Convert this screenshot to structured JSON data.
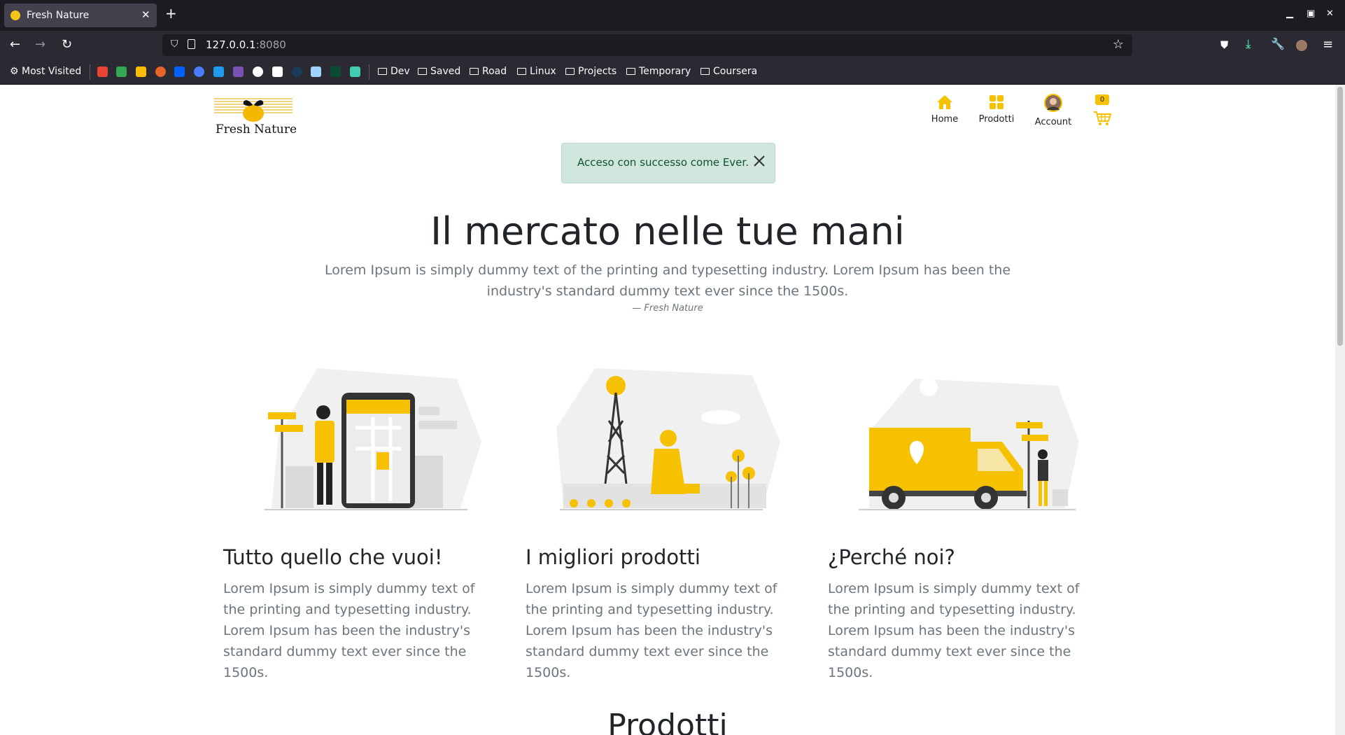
{
  "browser": {
    "tab_title": "Fresh Nature",
    "tab_close": "✕",
    "new_tab": "+",
    "url_host": "127.0.0.1",
    "url_port": ":8080",
    "bookmarks": {
      "most_visited": "Most Visited",
      "folders": [
        "Dev",
        "Saved",
        "Road",
        "Linux",
        "Projects",
        "Temporary",
        "Coursera"
      ]
    },
    "icons": [
      "back-arrow-icon",
      "forward-arrow-icon",
      "reload-icon",
      "shield-icon",
      "star-icon",
      "pocket-icon",
      "download-icon",
      "wrench-icon",
      "account-icon",
      "menu-icon"
    ]
  },
  "site": {
    "logo_text": "Fresh Nature",
    "nav": {
      "home": "Home",
      "products": "Prodotti",
      "account": "Account",
      "cart_count": "0"
    },
    "alert": {
      "message": "Acceso con successo come Ever."
    },
    "hero": {
      "title": "Il mercato nelle tue mani",
      "text": "Lorem Ipsum is simply dummy text of the printing and typesetting industry. Lorem Ipsum has been the industry's standard dummy text ever since the 1500s.",
      "cite": "— Fresh Nature"
    },
    "features": [
      {
        "title": "Tutto quello che vuoi!",
        "text": "Lorem Ipsum is simply dummy text of the printing and typesetting industry. Lorem Ipsum has been the industry's standard dummy text ever since the 1500s."
      },
      {
        "title": "I migliori prodotti",
        "text": "Lorem Ipsum is simply dummy text of the printing and typesetting industry. Lorem Ipsum has been the industry's standard dummy text ever since the 1500s."
      },
      {
        "title": "¿Perché noi?",
        "text": "Lorem Ipsum is simply dummy text of the printing and typesetting industry. Lorem Ipsum has been the industry's standard dummy text ever since the 1500s."
      }
    ],
    "section_title": "Prodotti"
  },
  "colors": {
    "accent": "#f5c100",
    "alert_bg": "#d1e7dd",
    "alert_text": "#0f5132"
  }
}
